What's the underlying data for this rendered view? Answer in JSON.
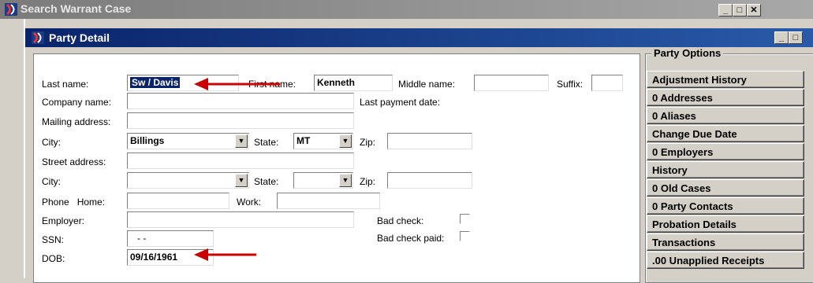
{
  "outer_window": {
    "title": "Search Warrant Case"
  },
  "inner_window": {
    "title": "Party Detail"
  },
  "labels": {
    "last_name": "Last name:",
    "first_name": "First name:",
    "middle_name": "Middle name:",
    "suffix": "Suffix:",
    "company_name": "Company name:",
    "last_payment_date": "Last payment date:",
    "mailing_address": "Mailing address:",
    "city": "City:",
    "state": "State:",
    "zip": "Zip:",
    "street_address": "Street address:",
    "phone_home": "Phone   Home:",
    "work": "Work:",
    "employer": "Employer:",
    "bad_check": "Bad check:",
    "ssn": "SSN:",
    "bad_check_paid": "Bad check paid:",
    "dob": "DOB:"
  },
  "values": {
    "last_name": "Sw / Davis",
    "first_name": "Kenneth",
    "middle_name": "",
    "suffix": "",
    "company_name": "",
    "mailing_address": "",
    "mailing_city": "Billings",
    "mailing_state": "MT",
    "mailing_zip": "",
    "street_address": "",
    "street_city": "",
    "street_state": "",
    "street_zip": "",
    "phone_home": "",
    "phone_work": "",
    "employer": "",
    "ssn": "- -",
    "dob": "09/16/1961"
  },
  "party_options": {
    "legend": "Party Options",
    "buttons": [
      "Adjustment History",
      "0 Addresses",
      "0 Aliases",
      "Change Due Date",
      "0 Employers",
      "History",
      "0 Old Cases",
      "0 Party Contacts",
      "Probation Details",
      "Transactions",
      ".00 Unapplied Receipts"
    ]
  },
  "annotation_color": "#cc0000",
  "title_gradient": [
    "#0a246a",
    "#2a5ba8"
  ]
}
